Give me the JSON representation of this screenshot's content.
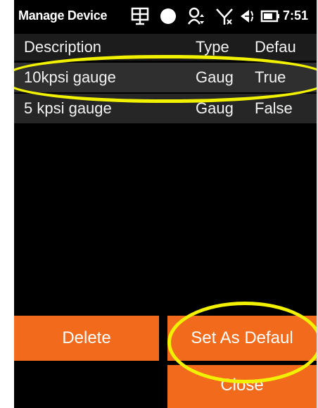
{
  "statusbar": {
    "title": "Manage Device",
    "time": "7:51",
    "icons": [
      "grid-network-icon",
      "circle-icon",
      "user-sync-icon",
      "no-signal-icon",
      "speaker-icon",
      "battery-icon"
    ]
  },
  "table": {
    "headers": [
      "Description",
      "Type",
      "Defau"
    ],
    "rows": [
      {
        "description": "10kpsi gauge",
        "type": "Gaug",
        "default": "True"
      },
      {
        "description": "5 kpsi gauge",
        "type": "Gaug",
        "default": "False"
      }
    ]
  },
  "buttons": {
    "delete": "Delete",
    "set_default": "Set As Defaul",
    "close": "Close"
  },
  "colors": {
    "accent": "#f26b1d",
    "highlight": "#f2f200",
    "background": "#000000"
  }
}
